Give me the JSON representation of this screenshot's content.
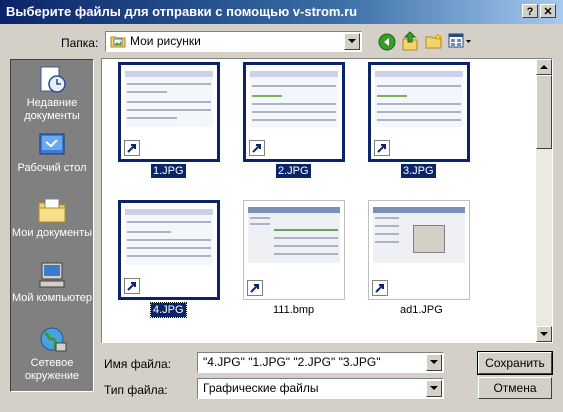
{
  "window": {
    "title": "Выберите файлы для отправки с помощью v-strom.ru",
    "help_button": "?",
    "close_button": "✕"
  },
  "toolbar": {
    "location_label": "Папка:",
    "location_value": "Мои рисунки"
  },
  "places": [
    {
      "label": "Недавние документы",
      "icon": "recent-documents-icon"
    },
    {
      "label": "Рабочий стол",
      "icon": "desktop-icon"
    },
    {
      "label": "Мои документы",
      "icon": "my-documents-icon"
    },
    {
      "label": "Мой компьютер",
      "icon": "my-computer-icon"
    },
    {
      "label": "Сетевое окружение",
      "icon": "network-icon"
    }
  ],
  "files": [
    {
      "name": "1.JPG",
      "selected": true
    },
    {
      "name": "2.JPG",
      "selected": true
    },
    {
      "name": "3.JPG",
      "selected": true
    },
    {
      "name": "4.JPG",
      "selected": true
    },
    {
      "name": "111.bmp",
      "selected": false
    },
    {
      "name": "ad1.JPG",
      "selected": false
    }
  ],
  "filename": {
    "label": "Имя файла:",
    "value": "\"4.JPG\" \"1.JPG\" \"2.JPG\" \"3.JPG\""
  },
  "filetype": {
    "label": "Тип файла:",
    "value": "Графические файлы"
  },
  "buttons": {
    "save": "Сохранить",
    "cancel": "Отмена"
  }
}
